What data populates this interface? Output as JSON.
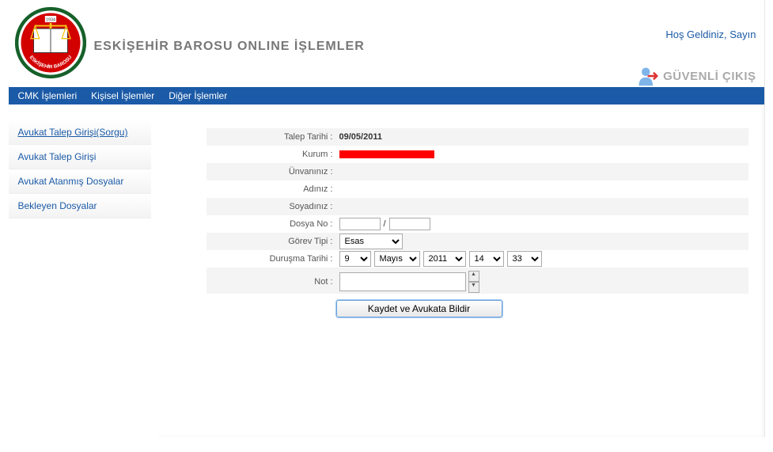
{
  "header": {
    "site_title": "ESKİŞEHİR BAROSU ONLINE İŞLEMLER",
    "welcome": "Hoş Geldiniz, Sayın",
    "logout_label": "GÜVENLİ ÇIKIŞ",
    "logo_year": "1934",
    "logo_org": "ESKİŞEHİR BAROSU"
  },
  "topmenu": {
    "items": [
      "CMK İşlemleri",
      "Kişisel İşlemler",
      "Diğer İşlemler"
    ]
  },
  "sidebar": {
    "items": [
      {
        "label": "Avukat Talep Girişi(Sorgu)",
        "active": true
      },
      {
        "label": "Avukat Talep Girişi",
        "active": false
      },
      {
        "label": "Avukat Atanmış Dosyalar",
        "active": false
      },
      {
        "label": "Bekleyen Dosyalar",
        "active": false
      }
    ]
  },
  "form": {
    "labels": {
      "talep_tarihi": "Talep Tarihi :",
      "kurum": "Kurum :",
      "unvan": "Ünvanınız :",
      "ad": "Adınız :",
      "soyad": "Soyadınız :",
      "dosya_no": "Dosya No :",
      "gorev_tipi": "Görev Tipi :",
      "durusma_tarihi": "Duruşma Tarihi :",
      "not": "Not :"
    },
    "values": {
      "talep_tarihi": "09/05/2011",
      "unvan": "",
      "ad": "",
      "soyad": "",
      "dosya_sep": "/",
      "gorev_tipi": "Esas",
      "dur_day": "9",
      "dur_mon": "Mayıs",
      "dur_yr": "2011",
      "dur_hh": "14",
      "dur_mm": "33"
    },
    "submit_label": "Kaydet ve Avukata Bildir"
  }
}
